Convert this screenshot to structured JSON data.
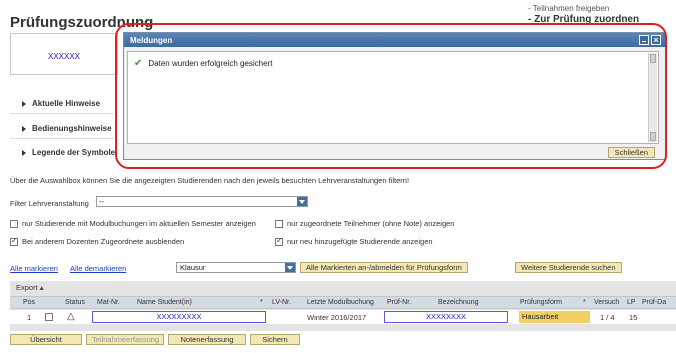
{
  "header": {
    "title": "Prüfungszuordnung",
    "top_link_1": "- Teilnahmen freigeben",
    "top_link_2": "- Zur Prüfung zuordnen"
  },
  "card": {
    "id": "XXXXXX"
  },
  "sections": [
    {
      "label": "Aktuelle Hinweise"
    },
    {
      "label": "Bedienungshinweise"
    },
    {
      "label": "Legende der Symbole"
    }
  ],
  "modal": {
    "title": "Meldungen",
    "message": "Daten wurden erfolgreich gesichert",
    "close_label": "Schließen"
  },
  "info_text": "Über die Auswahlbox können Sie die angezeigten Studierenden nach den jeweils besuchten Lehrveranstaltungen filtern!",
  "filter": {
    "label": "Filter Lehrveranstaltung",
    "value": "--"
  },
  "options": [
    {
      "label": "nur Studierende mit Modulbuchungen im aktuellen Semester anzeigen",
      "checked": false
    },
    {
      "label": "nur zugeordnete Teilnehmer (ohne Note) anzeigen",
      "checked": false
    },
    {
      "label": "Bei anderem Dozenten Zugeordnete ausblenden",
      "checked": true
    },
    {
      "label": "nur neu hinzugefügte Studierende anzeigen",
      "checked": true
    }
  ],
  "actions": {
    "mark_all": "Alle markieren",
    "unmark_all": "Alle demarkieren",
    "exam_form_value": "Klausur",
    "bulk_button": "Alle Markierten an-/abmelden für Prüfungsform",
    "more_students": "Weitere Studierende suchen"
  },
  "table": {
    "export_label": "Export ▴",
    "columns": [
      "Pos",
      "Status",
      "Mat-Nr.",
      "Name Student(in)",
      "*",
      "LV-Nr.",
      "Letzte Modulbuchung",
      "Prüf-Nr.",
      "Bezeichnung",
      "Prüfungsform",
      "*",
      "Versuch",
      "LP",
      "Prüf-Da"
    ],
    "rows": [
      {
        "pos": "1",
        "status": "△",
        "name": "XXXXXXXXX",
        "letzte": "Winter 2016/2017",
        "bezeichnung": "XXXXXXXX",
        "form": "Hausarbeit",
        "versuch": "1 / 4",
        "lp": "15"
      }
    ]
  },
  "bottom": {
    "overview": "Übersicht",
    "participation": "Teilnahmeerfassung",
    "grades": "Notenerfassung",
    "save": "Sichern"
  },
  "colors": {
    "accent_red": "#e02020",
    "button_yellow": "#f3e7b5",
    "header_blue": "#3e6a9e",
    "highlight": "#f2cf63"
  }
}
